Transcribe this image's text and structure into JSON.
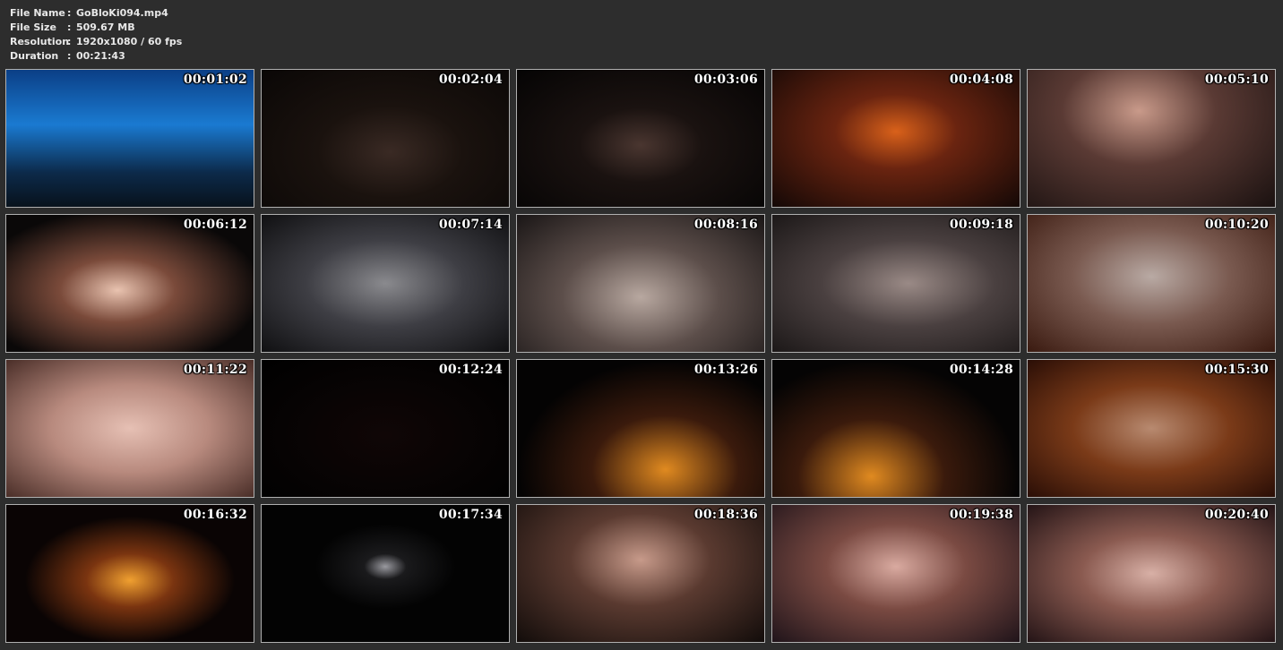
{
  "header": {
    "file_name_label": "File Name",
    "file_name_sep": ":",
    "file_name_value": "GoBloKi094.mp4",
    "file_size_label": "File Size",
    "file_size_sep": ":",
    "file_size_value": "509.67 MB",
    "resolution_label": "Resolution",
    "resolution_sep": ":",
    "resolution_value": "1920x1080 / 60 fps",
    "duration_label": "Duration",
    "duration_sep": ":",
    "duration_value": "00:21:43"
  },
  "thumbnails": [
    {
      "time": "00:01:02",
      "bg": "linear-gradient(180deg,#0b3f86 0%,#1a7ad1 40%,#0c2a4a 75%,#08121c 100%)"
    },
    {
      "time": "00:02:04",
      "bg": "radial-gradient(ellipse at 52% 60%,#3a2a24 0%,#1a120e 40%,#0a0706 100%)"
    },
    {
      "time": "00:03:06",
      "bg": "radial-gradient(ellipse at 50% 55%,#4a3630 0%,#1a1210 35%,#050404 100%)"
    },
    {
      "time": "00:04:08",
      "bg": "radial-gradient(ellipse at 50% 45%,#d9611a 0%,#6a2410 35%,#140806 100%)"
    },
    {
      "time": "00:05:10",
      "bg": "radial-gradient(ellipse at 45% 30%,#c99a8a 0%,#5a3a34 40%,#1a1110 100%)"
    },
    {
      "time": "00:06:12",
      "bg": "radial-gradient(ellipse at 45% 55%,#e9c3b0 0%,#7a4a3a 30%,#0a0808 75%)"
    },
    {
      "time": "00:07:14",
      "bg": "radial-gradient(ellipse at 50% 50%,#8a8a8e 0%,#3e3e44 45%,#101012 100%)"
    },
    {
      "time": "00:08:16",
      "bg": "radial-gradient(ellipse at 50% 60%,#b8a8a0 0%,#5c4e4a 45%,#1a1616 100%)"
    },
    {
      "time": "00:09:18",
      "bg": "radial-gradient(ellipse at 55% 50%,#9a8a86 0%,#4a4040 45%,#1c1818 100%)"
    },
    {
      "time": "00:10:20",
      "bg": "radial-gradient(ellipse at 50% 45%,#b9aaa4 0%,#7a5a50 45%,#3a1a10 100%)"
    },
    {
      "time": "00:11:22",
      "bg": "radial-gradient(ellipse at 50% 50%,#e6c0b4 0%,#b88a7e 45%,#4a2e28 100%)"
    },
    {
      "time": "00:12:24",
      "bg": "radial-gradient(ellipse at 50% 55%,#100606 0%,#060303 60%,#000000 100%)"
    },
    {
      "time": "00:13:26",
      "bg": "radial-gradient(ellipse at 60% 80%,#e08a20 0%,#3a1a0c 35%,#040303 70%)"
    },
    {
      "time": "00:14:28",
      "bg": "radial-gradient(ellipse at 40% 85%,#e08a20 0%,#3a1a0c 35%,#050404 70%)"
    },
    {
      "time": "00:15:30",
      "bg": "radial-gradient(ellipse at 50% 50%,#b88a70 0%,#7a3a18 45%,#2a0e06 100%)"
    },
    {
      "time": "00:16:32",
      "bg": "radial-gradient(ellipse at 50% 55%,#f0a030 0%,#7a3410 25%,#0a0404 60%)"
    },
    {
      "time": "00:17:34",
      "bg": "radial-gradient(ellipse at 50% 45%,#9a9aa0 0%,#1a1a1c 12%,#030303 40%)"
    },
    {
      "time": "00:18:36",
      "bg": "radial-gradient(ellipse at 50% 40%,#c79a8a 0%,#5a3a30 40%,#120c0a 100%)"
    },
    {
      "time": "00:19:38",
      "bg": "radial-gradient(ellipse at 50% 45%,#d9aaa0 0%,#7a4a42 40%,#20141a 100%)"
    },
    {
      "time": "00:20:40",
      "bg": "radial-gradient(ellipse at 50% 50%,#d8b0a6 0%,#8a5a50 40%,#241416 100%)"
    }
  ]
}
